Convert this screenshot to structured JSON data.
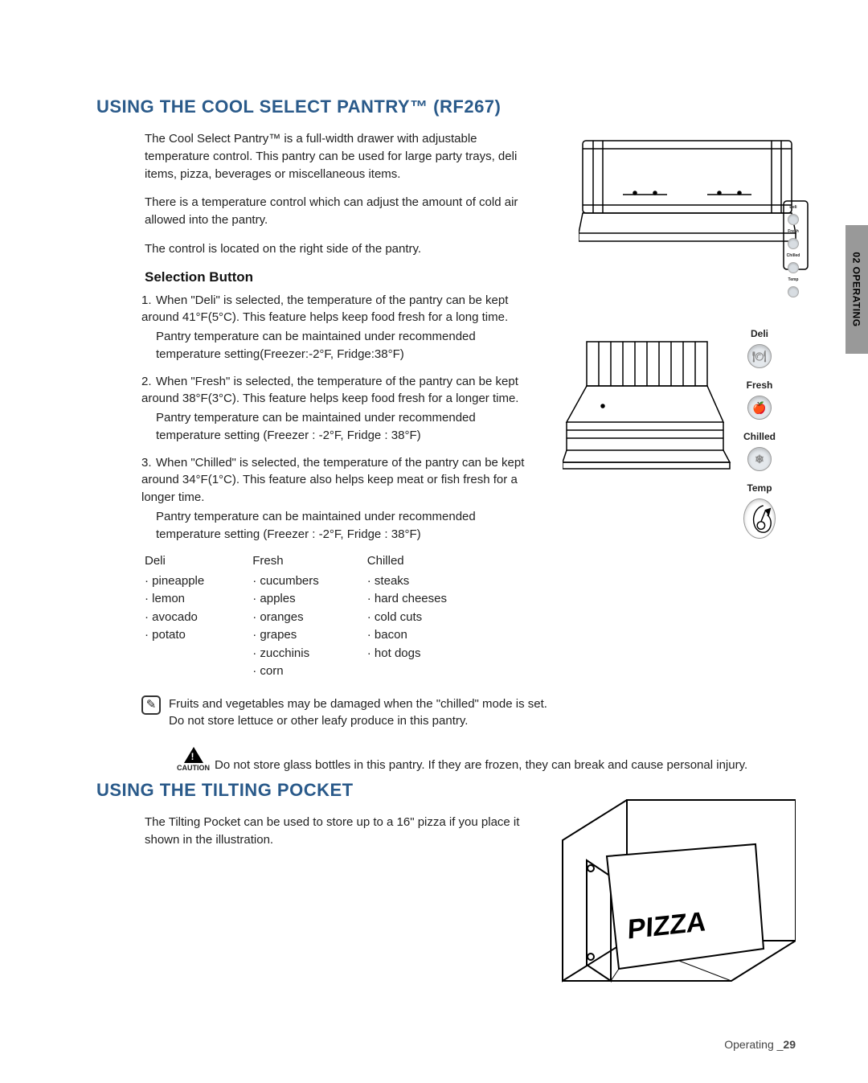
{
  "side_tab": "02 OPERATING",
  "section1": {
    "title": "USING THE COOL SELECT PANTRY™ (RF267)",
    "p1": "The Cool Select Pantry™ is a full-width drawer with adjustable temperature control. This pantry can be used for large party trays, deli items, pizza, beverages or miscellaneous items.",
    "p2": "There is a temperature control which can adjust the amount of cold air allowed into the pantry.",
    "p3": "The control is located on the right side of the pantry.",
    "sub": "Selection Button",
    "items": [
      {
        "num": "1.",
        "head": "When \"Deli\" is selected, the temperature of the pantry can be kept around 41°F(5°C). This feature helps keep food fresh for a long time.",
        "cont": "Pantry temperature can be maintained under recommended temperature setting(Freezer:-2°F, Fridge:38°F)"
      },
      {
        "num": "2.",
        "head": "When \"Fresh\" is selected, the temperature of the pantry can be kept around 38°F(3°C). This feature helps keep food fresh for a longer time.",
        "cont": "Pantry temperature can be maintained under recommended temperature setting (Freezer : -2°F, Fridge : 38°F)"
      },
      {
        "num": "3.",
        "head": "When \"Chilled\" is selected, the temperature of the pantry can be kept around 34°F(1°C). This feature also helps keep meat or fish fresh for a longer time.",
        "cont": "Pantry temperature can be maintained under recommended temperature setting (Freezer : -2°F, Fridge : 38°F)"
      }
    ],
    "cols": {
      "deli": {
        "head": "Deli",
        "items": [
          "· pineapple",
          "· lemon",
          "· avocado",
          "· potato"
        ]
      },
      "fresh": {
        "head": "Fresh",
        "items": [
          "· cucumbers",
          "· apples",
          "· oranges",
          "· grapes",
          "· zucchinis",
          "· corn"
        ]
      },
      "chilled": {
        "head": "Chilled",
        "items": [
          "· steaks",
          "· hard cheeses",
          "· cold cuts",
          "· bacon",
          "· hot dogs"
        ]
      }
    },
    "note1": "Fruits and vegetables may be damaged when the \"chilled\" mode is set.",
    "note2": "Do not store lettuce or other leafy produce in this pantry.",
    "caution_label": "CAUTION",
    "caution_text": "Do not store glass bottles in this pantry. If they are frozen, they can break and cause personal injury."
  },
  "panel_mini": {
    "l1": "Deli",
    "l2": "Fresh",
    "l3": "Chilled",
    "l4": "Temp"
  },
  "panel_big": {
    "l1": "Deli",
    "l2": "Fresh",
    "l3": "Chilled",
    "l4": "Temp"
  },
  "section2": {
    "title": "USING THE TILTING POCKET",
    "p1": "The Tilting Pocket can be used to store up to a 16\" pizza if you place it shown in the illustration.",
    "pizza": "PIZZA"
  },
  "footer": {
    "label": "Operating _",
    "page": "29"
  }
}
